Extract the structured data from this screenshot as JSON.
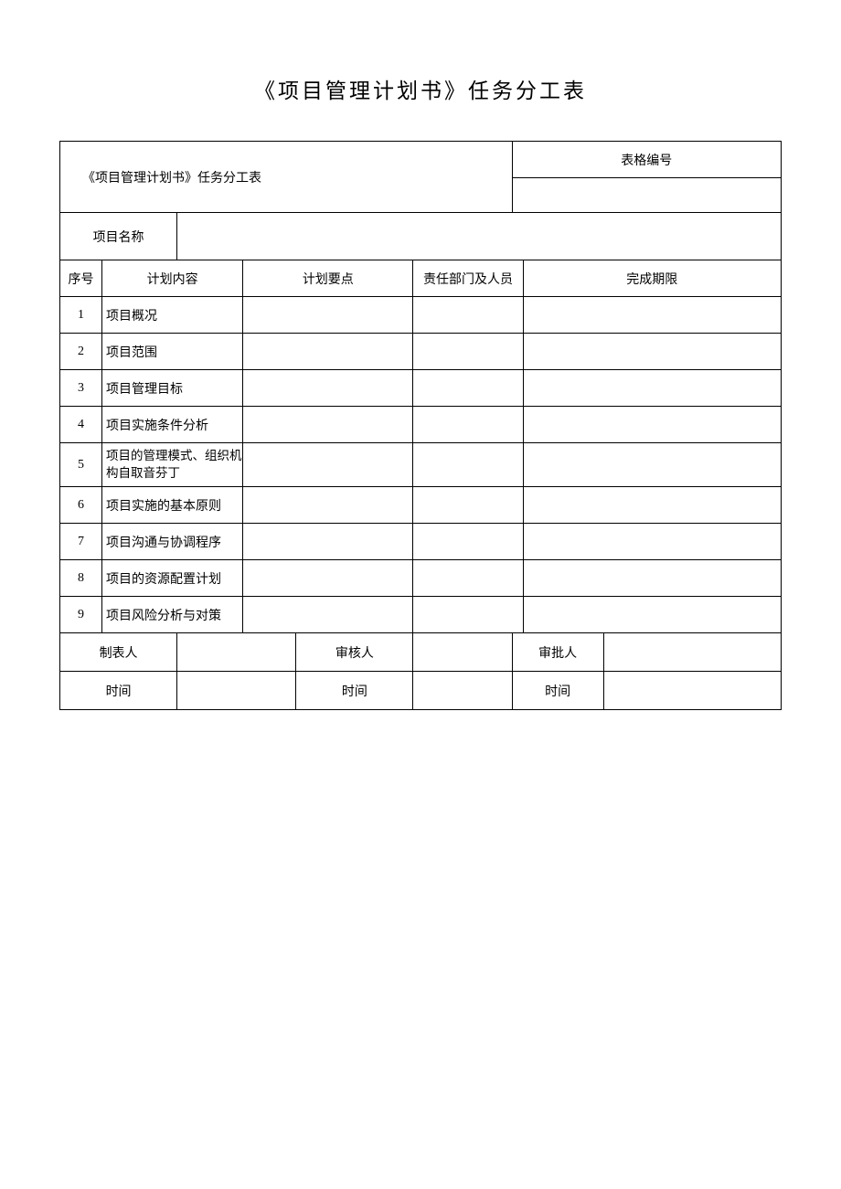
{
  "page_title": "《项目管理计划书》任务分工表",
  "subtitle": "《项目管理计划书》任务分工表",
  "form_number_label": "表格编号",
  "form_number_value": "",
  "project_name_label": "项目名称",
  "project_name_value": "",
  "headers": {
    "seq": "序号",
    "plan_content": "计划内容",
    "plan_points": "计划要点",
    "responsible": "责任部门及人员",
    "deadline": "完成期限"
  },
  "rows": [
    {
      "seq": "1",
      "content": "项目概况",
      "points": "",
      "responsible": "",
      "deadline": ""
    },
    {
      "seq": "2",
      "content": "项目范围",
      "points": "",
      "responsible": "",
      "deadline": ""
    },
    {
      "seq": "3",
      "content": "项目管理目标",
      "points": "",
      "responsible": "",
      "deadline": ""
    },
    {
      "seq": "4",
      "content": "项目实施条件分析",
      "points": "",
      "responsible": "",
      "deadline": ""
    },
    {
      "seq": "5",
      "content": "项目的管理模式、组织机构自取音芬丁",
      "points": "",
      "responsible": "",
      "deadline": ""
    },
    {
      "seq": "6",
      "content": "项目实施的基本原则",
      "points": "",
      "responsible": "",
      "deadline": ""
    },
    {
      "seq": "7",
      "content": "项目沟通与协调程序",
      "points": "",
      "responsible": "",
      "deadline": ""
    },
    {
      "seq": "8",
      "content": "项目的资源配置计划",
      "points": "",
      "responsible": "",
      "deadline": ""
    },
    {
      "seq": "9",
      "content": "项目风险分析与对策",
      "points": "",
      "responsible": "",
      "deadline": ""
    }
  ],
  "footer": {
    "preparer_label": "制表人",
    "preparer_value": "",
    "reviewer_label": "审核人",
    "reviewer_value": "",
    "approver_label": "审批人",
    "approver_value": "",
    "preparer_time_label": "时间",
    "preparer_time_value": "",
    "reviewer_time_label": "时间",
    "reviewer_time_value": "",
    "approver_time_label": "时间",
    "approver_time_value": ""
  }
}
